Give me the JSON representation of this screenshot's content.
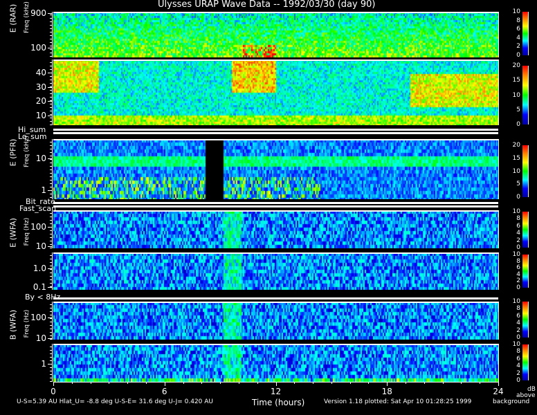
{
  "title": "Ulysses URAP Wave Data -- 1992/03/30  (day 90)",
  "footer": {
    "orbit": "U-S=5.39 AU  Hlat_U= -8.8 deg  U-S-E= 31.6 deg  U-J= 0.420 AU",
    "version": "Version 1.18 plotted: Sat Apr 10 01:28:25 1999",
    "colorbar_unit": [
      "dB",
      "above",
      "background"
    ]
  },
  "chart_data": {
    "type": "heatmap",
    "xlabel": "Time (hours)",
    "xlim": [
      0,
      24
    ],
    "xticks": [
      "0",
      "6",
      "12",
      "18",
      "24"
    ],
    "panels": [
      {
        "id": "rar-high",
        "ylabel": "E (RAR)",
        "yunit": "Freq (kHz)",
        "yticks": [
          "900",
          "100"
        ],
        "colorbar": {
          "range": [
            0,
            10
          ],
          "ticks": [
            "10",
            "8",
            "6",
            "4",
            "2",
            "0"
          ]
        }
      },
      {
        "id": "rar-low",
        "ylabel": "",
        "yunit": "",
        "yticks": [
          "40",
          "30",
          "20",
          "10"
        ],
        "colorbar": {
          "range": [
            0,
            20
          ],
          "ticks": [
            "20",
            "15",
            "10",
            "5",
            "0"
          ]
        }
      },
      {
        "id": "pfr",
        "ylabel": "E (PFR)",
        "yunit": "Freq (kHz)",
        "yticks": [
          "10",
          "1"
        ],
        "colorbar": {
          "range": [
            0,
            24
          ],
          "ticks": [
            "20",
            "15",
            "10",
            "5",
            "0"
          ]
        }
      },
      {
        "id": "wfa-e-high",
        "ylabel": "E (WFA)",
        "yunit": "Freq (Hz)",
        "yticks": [
          "100",
          "10"
        ],
        "colorbar": {
          "range": [
            0,
            10
          ],
          "ticks": [
            "10",
            "8",
            "6",
            "4",
            "2",
            "0"
          ]
        }
      },
      {
        "id": "wfa-e-low",
        "ylabel": "",
        "yunit": "",
        "yticks": [
          "1.0",
          "0.1"
        ],
        "colorbar": {
          "range": [
            0,
            10
          ],
          "ticks": [
            "10",
            "8",
            "6",
            "4",
            "2",
            "0"
          ]
        }
      },
      {
        "id": "wfa-b-high",
        "ylabel": "B (WFA)",
        "yunit": "Freq (Hz)",
        "yticks": [
          "100",
          "10"
        ],
        "colorbar": {
          "range": [
            0,
            10
          ],
          "ticks": [
            "10",
            "8",
            "6",
            "4",
            "2",
            "0"
          ]
        }
      },
      {
        "id": "wfa-b-low",
        "ylabel": "",
        "yunit": "",
        "yticks": [
          "1"
        ],
        "colorbar": {
          "range": [
            0,
            10
          ],
          "ticks": [
            "10",
            "8",
            "6",
            "4",
            "2",
            "0"
          ]
        }
      }
    ],
    "status_bars": [
      "Hi_sum",
      "Lo_sum",
      "Bit_rate",
      "Fast_scan",
      "By < 8Hz"
    ],
    "colormap": [
      "#000000",
      "#0000ff",
      "#00ffff",
      "#00ff00",
      "#ffff00",
      "#ff0000"
    ]
  }
}
